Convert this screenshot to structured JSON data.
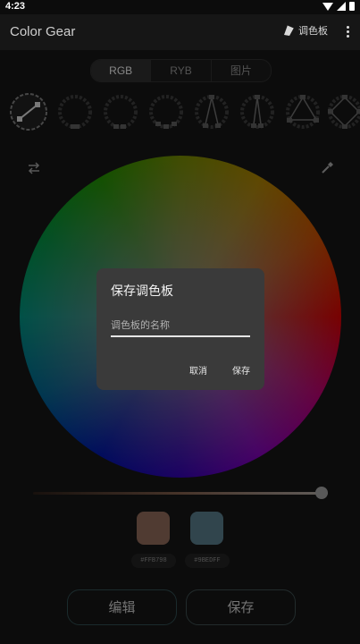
{
  "status": {
    "time": "4:23"
  },
  "app": {
    "title": "Color Gear",
    "palette_label": "调色板"
  },
  "tabs": [
    {
      "label": "RGB",
      "active": true
    },
    {
      "label": "RYB",
      "active": false
    },
    {
      "label": "图片",
      "active": false
    }
  ],
  "harmony_icons": [
    "complementary-icon",
    "monochrome-icon",
    "analogous-icon",
    "analogous-wide-icon",
    "split-complementary-icon",
    "split-complementary-narrow-icon",
    "triad-icon",
    "tetrad-icon"
  ],
  "swatches": [
    {
      "hex": "#FFB798",
      "display": "#8a6656"
    },
    {
      "hex": "#9BEDFF",
      "display": "#557886"
    }
  ],
  "buttons": {
    "edit": "编辑",
    "save": "保存"
  },
  "slider": {
    "value": 0.98
  },
  "dialog": {
    "title": "保存调色板",
    "input_placeholder": "调色板的名称",
    "input_value": "",
    "cancel": "取消",
    "save": "保存"
  }
}
